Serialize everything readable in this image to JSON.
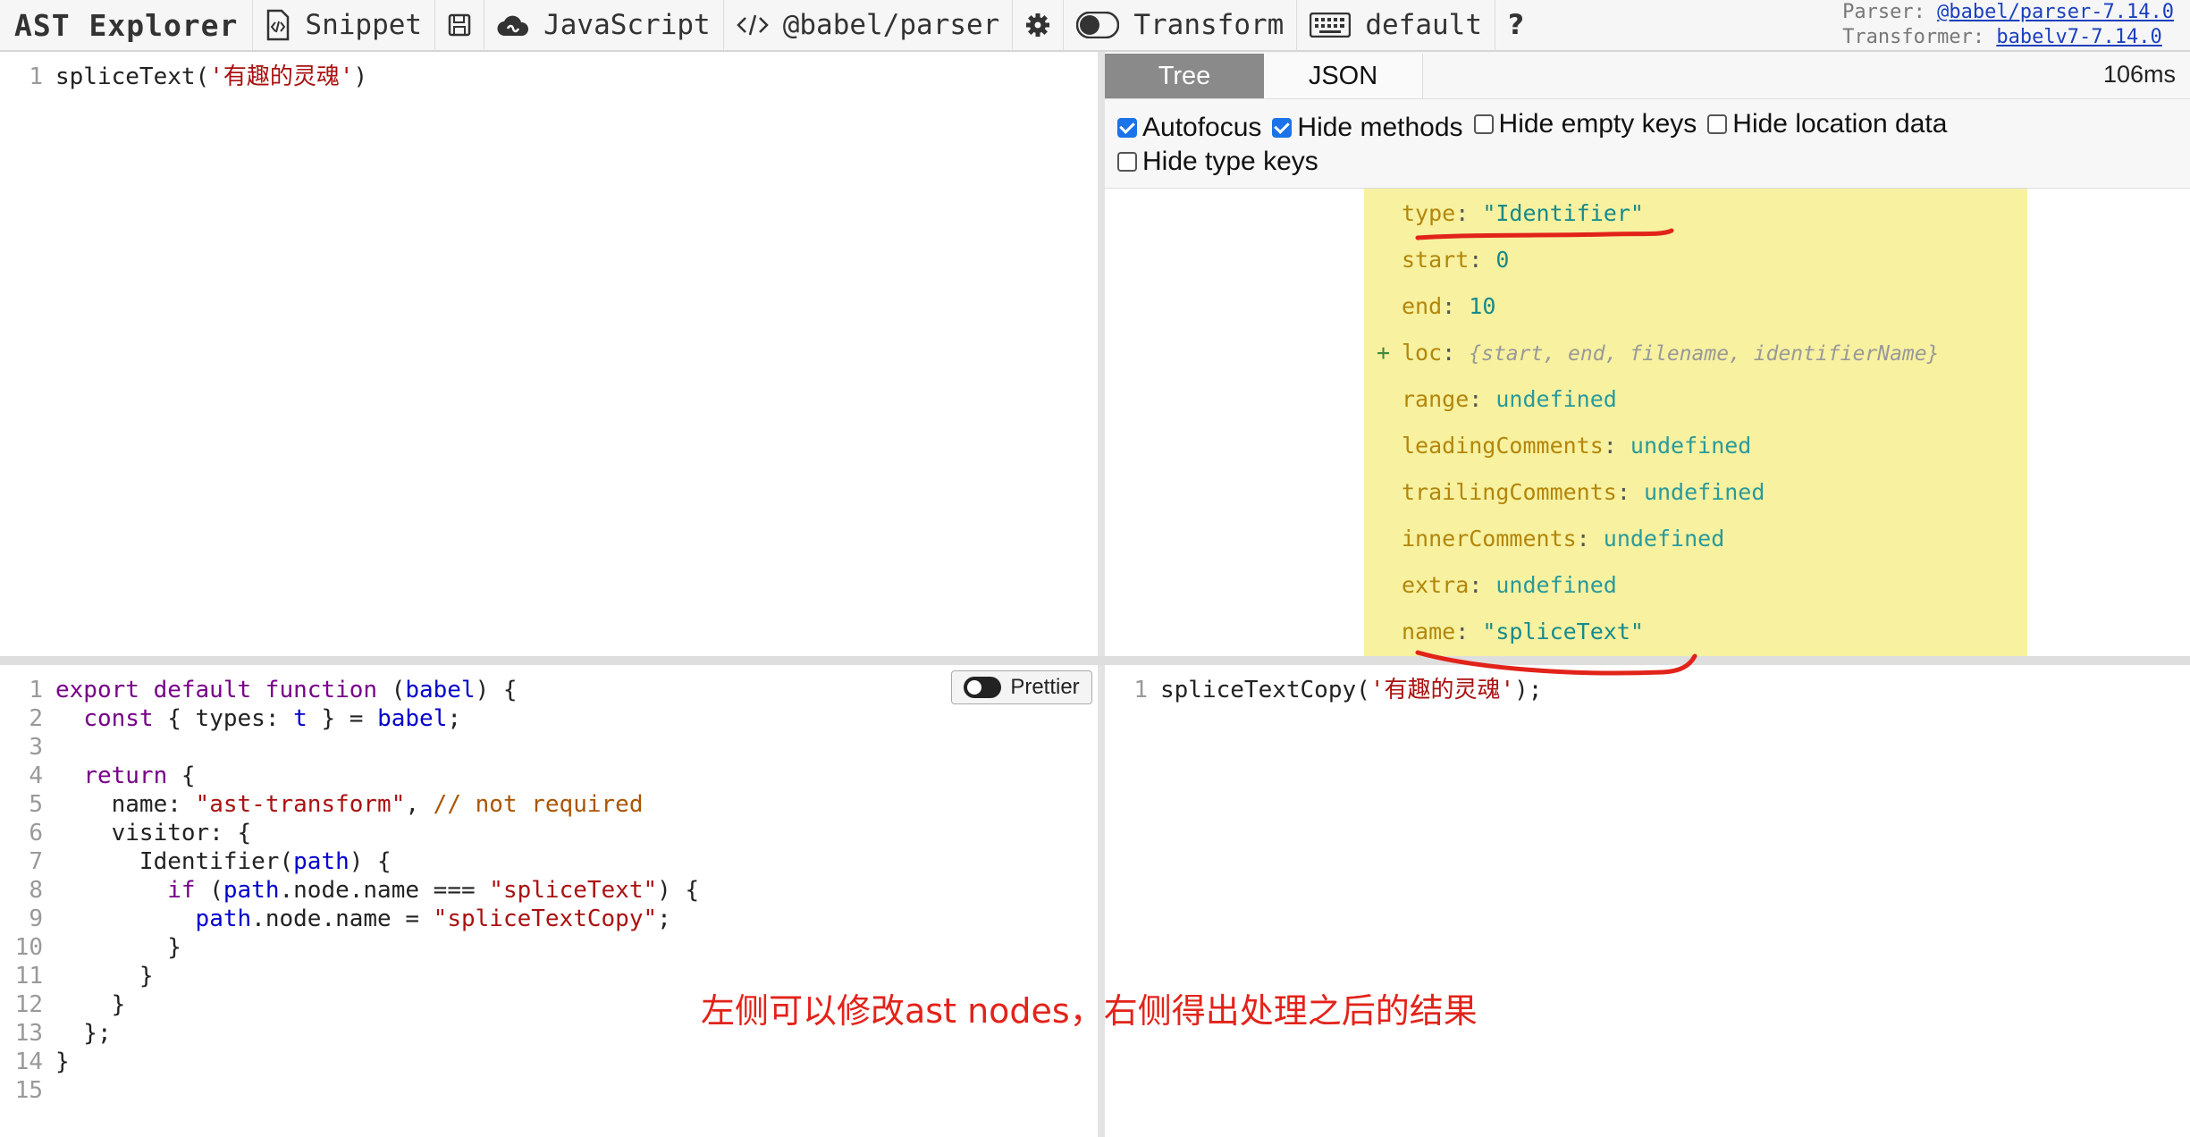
{
  "toolbar": {
    "brand": "AST Explorer",
    "snippet_label": "Snippet",
    "language_label": "JavaScript",
    "parser_label": "@babel/parser",
    "transform_label": "Transform",
    "keymap_label": "default",
    "help_label": "?",
    "meta": {
      "parser_prefix": "Parser:",
      "parser_link": "@babel/parser-7.14.0",
      "transformer_prefix": "Transformer:",
      "transformer_link": "babelv7-7.14.0"
    }
  },
  "source": {
    "lines": [
      {
        "num": "1",
        "tokens": [
          {
            "t": "spliceText(",
            "c": ""
          },
          {
            "t": "'有趣的灵魂'",
            "c": "str"
          },
          {
            "t": ")",
            "c": ""
          }
        ]
      }
    ]
  },
  "tree": {
    "tabs": [
      "Tree",
      "JSON"
    ],
    "parse_time": "106ms",
    "options": [
      {
        "label": "Autofocus",
        "checked": true
      },
      {
        "label": "Hide methods",
        "checked": true
      },
      {
        "label": "Hide empty keys",
        "checked": false
      },
      {
        "label": "Hide location data",
        "checked": false
      },
      {
        "label": "Hide type keys",
        "checked": false
      }
    ],
    "properties": [
      {
        "key": "type",
        "value": "\"Identifier\"",
        "kind": "str"
      },
      {
        "key": "start",
        "value": "0",
        "kind": "num"
      },
      {
        "key": "end",
        "value": "10",
        "kind": "num"
      },
      {
        "key": "loc",
        "value": "{start, end, filename, identifierName}",
        "kind": "obj",
        "expandable": "+"
      },
      {
        "key": "range",
        "value": "undefined",
        "kind": "undef"
      },
      {
        "key": "leadingComments",
        "value": "undefined",
        "kind": "undef"
      },
      {
        "key": "trailingComments",
        "value": "undefined",
        "kind": "undef"
      },
      {
        "key": "innerComments",
        "value": "undefined",
        "kind": "undef"
      },
      {
        "key": "extra",
        "value": "undefined",
        "kind": "undef"
      },
      {
        "key": "name",
        "value": "\"spliceText\"",
        "kind": "str"
      }
    ]
  },
  "transform": {
    "prettier_label": "Prettier",
    "lines": [
      {
        "num": "1",
        "tokens": [
          {
            "t": "export default function",
            "c": "kw"
          },
          {
            "t": " (",
            "c": ""
          },
          {
            "t": "babel",
            "c": "var"
          },
          {
            "t": ") {",
            "c": ""
          }
        ]
      },
      {
        "num": "2",
        "tokens": [
          {
            "t": "  ",
            "c": ""
          },
          {
            "t": "const",
            "c": "kw"
          },
          {
            "t": " { types: ",
            "c": ""
          },
          {
            "t": "t",
            "c": "var"
          },
          {
            "t": " } = ",
            "c": ""
          },
          {
            "t": "babel",
            "c": "var"
          },
          {
            "t": ";",
            "c": ""
          }
        ]
      },
      {
        "num": "3",
        "tokens": []
      },
      {
        "num": "4",
        "tokens": [
          {
            "t": "  ",
            "c": ""
          },
          {
            "t": "return",
            "c": "kw"
          },
          {
            "t": " {",
            "c": ""
          }
        ]
      },
      {
        "num": "5",
        "tokens": [
          {
            "t": "    name: ",
            "c": ""
          },
          {
            "t": "\"ast-transform\"",
            "c": "str"
          },
          {
            "t": ", ",
            "c": ""
          },
          {
            "t": "// not required",
            "c": "cmt"
          }
        ]
      },
      {
        "num": "6",
        "tokens": [
          {
            "t": "    visitor: {",
            "c": ""
          }
        ]
      },
      {
        "num": "7",
        "tokens": [
          {
            "t": "      Identifier(",
            "c": ""
          },
          {
            "t": "path",
            "c": "var"
          },
          {
            "t": ") {",
            "c": ""
          }
        ]
      },
      {
        "num": "8",
        "tokens": [
          {
            "t": "        ",
            "c": ""
          },
          {
            "t": "if",
            "c": "kw"
          },
          {
            "t": " (",
            "c": ""
          },
          {
            "t": "path",
            "c": "var"
          },
          {
            "t": ".node.name === ",
            "c": ""
          },
          {
            "t": "\"spliceText\"",
            "c": "str"
          },
          {
            "t": ") {",
            "c": ""
          }
        ]
      },
      {
        "num": "9",
        "tokens": [
          {
            "t": "          ",
            "c": ""
          },
          {
            "t": "path",
            "c": "var"
          },
          {
            "t": ".node.name = ",
            "c": ""
          },
          {
            "t": "\"spliceTextCopy\"",
            "c": "str"
          },
          {
            "t": ";",
            "c": ""
          }
        ]
      },
      {
        "num": "10",
        "tokens": [
          {
            "t": "        }",
            "c": ""
          }
        ]
      },
      {
        "num": "11",
        "tokens": [
          {
            "t": "      }",
            "c": ""
          }
        ]
      },
      {
        "num": "12",
        "tokens": [
          {
            "t": "    }",
            "c": ""
          }
        ]
      },
      {
        "num": "13",
        "tokens": [
          {
            "t": "  };",
            "c": ""
          }
        ]
      },
      {
        "num": "14",
        "tokens": [
          {
            "t": "}",
            "c": ""
          }
        ]
      },
      {
        "num": "15",
        "tokens": []
      }
    ]
  },
  "output": {
    "lines": [
      {
        "num": "1",
        "tokens": [
          {
            "t": "spliceTextCopy(",
            "c": ""
          },
          {
            "t": "'有趣的灵魂'",
            "c": "str"
          },
          {
            "t": ");",
            "c": ""
          }
        ]
      }
    ]
  },
  "annotation": {
    "text": "左侧可以修改ast nodes，右侧得出处理之后的结果",
    "color": "#e2231a"
  }
}
